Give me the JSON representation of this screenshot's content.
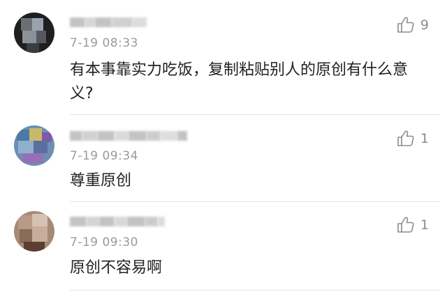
{
  "comments": [
    {
      "time": "7-19 08:33",
      "text": "有本事靠实力吃饭，复制粘贴别人的原创有什么意义?",
      "likes": "9",
      "avatar_colors": [
        "#2a2a2a",
        "#6b6f75",
        "#9aa3ad"
      ]
    },
    {
      "time": "7-19 09:34",
      "text": "尊重原创",
      "likes": "1",
      "avatar_colors": [
        "#4a7ba6",
        "#7c5aa8",
        "#c9b86a"
      ]
    },
    {
      "time": "7-19 09:30",
      "text": "原创不容易啊",
      "likes": "1",
      "avatar_colors": [
        "#8a6a58",
        "#b99a86",
        "#5a3f33"
      ]
    }
  ],
  "icons": {
    "like": "thumbs-up-icon"
  },
  "colors": {
    "timestamp": "#9a9a9a",
    "text": "#222222",
    "like": "#8c8c8c",
    "divider": "#e5e5e5"
  }
}
